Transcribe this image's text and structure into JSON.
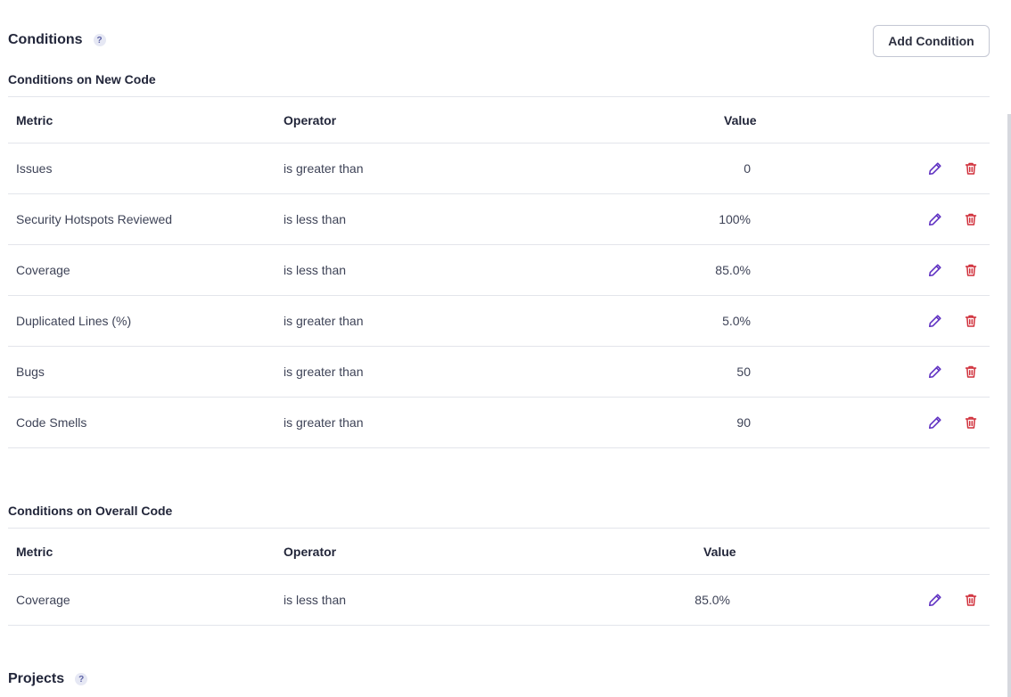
{
  "conditions": {
    "title": "Conditions",
    "help": "?",
    "add_button": "Add Condition"
  },
  "new_code": {
    "title": "Conditions on New Code",
    "headers": {
      "metric": "Metric",
      "operator": "Operator",
      "value": "Value"
    },
    "rows": [
      {
        "metric": "Issues",
        "operator": "is greater than",
        "value": "0"
      },
      {
        "metric": "Security Hotspots Reviewed",
        "operator": "is less than",
        "value": "100%"
      },
      {
        "metric": "Coverage",
        "operator": "is less than",
        "value": "85.0%"
      },
      {
        "metric": "Duplicated Lines (%)",
        "operator": "is greater than",
        "value": "5.0%"
      },
      {
        "metric": "Bugs",
        "operator": "is greater than",
        "value": "50"
      },
      {
        "metric": "Code Smells",
        "operator": "is greater than",
        "value": "90"
      }
    ]
  },
  "overall_code": {
    "title": "Conditions on Overall Code",
    "headers": {
      "metric": "Metric",
      "operator": "Operator",
      "value": "Value"
    },
    "rows": [
      {
        "metric": "Coverage",
        "operator": "is less than",
        "value": "85.0%"
      }
    ]
  },
  "projects": {
    "title": "Projects",
    "help": "?"
  },
  "icons": {
    "edit": "pencil-icon",
    "delete": "trash-icon"
  },
  "colors": {
    "edit_icon": "#5d2ec1",
    "delete_icon": "#d02f3a",
    "help_badge_bg": "#e6e8f4",
    "help_badge_fg": "#5d63a6"
  }
}
